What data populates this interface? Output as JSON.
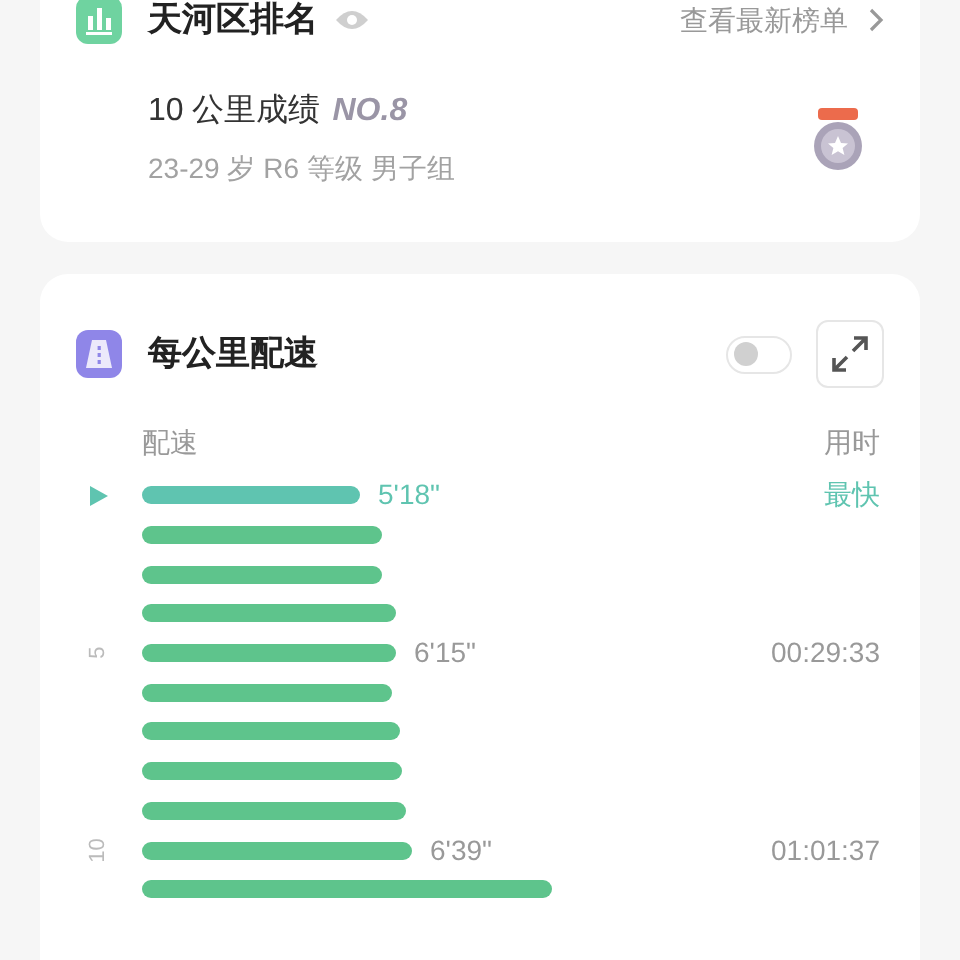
{
  "ranking": {
    "title": "天河区排名",
    "link": "查看最新榜单",
    "result_label": "10 公里成绩",
    "rank": "NO.8",
    "group": "23-29 岁 R6 等级 男子组"
  },
  "pace": {
    "title": "每公里配速",
    "toggle_on": false,
    "pace_header": "配速",
    "time_header": "用时",
    "rows": [
      {
        "fastest": true,
        "pace": "5'18\"",
        "time": "最快"
      },
      {
        "fastest": false
      },
      {
        "fastest": false
      },
      {
        "fastest": false
      },
      {
        "fastest": false,
        "km": "5",
        "pace": "6'15\"",
        "time": "00:29:33"
      },
      {
        "fastest": false
      },
      {
        "fastest": false
      },
      {
        "fastest": false
      },
      {
        "fastest": false
      },
      {
        "fastest": false,
        "km": "10",
        "pace": "6'39\"",
        "time": "01:01:37"
      },
      {
        "fastest": false
      }
    ]
  }
}
